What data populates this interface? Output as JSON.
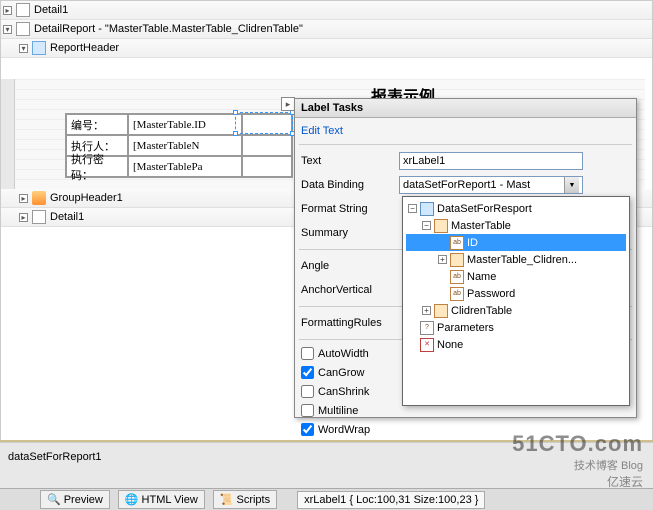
{
  "tree": {
    "detail1": "Detail1",
    "detailReport": "DetailReport - \"MasterTable.MasterTable_ClidrenTable\"",
    "reportHeader": "ReportHeader",
    "groupHeader": "GroupHeader1",
    "detail1b": "Detail1"
  },
  "design": {
    "title": "报表示例",
    "rows": [
      {
        "l": "编号：",
        "v": "[MasterTable.ID"
      },
      {
        "l": "执行人：",
        "v": "[MasterTableN"
      },
      {
        "l": "执行密码：",
        "v": "[MasterTablePa"
      }
    ]
  },
  "popup": {
    "title": "Label Tasks",
    "edit": "Edit Text",
    "props": {
      "text": {
        "label": "Text",
        "value": "xrLabel1"
      },
      "binding": {
        "label": "Data Binding",
        "value": "dataSetForReport1 - Mast"
      },
      "format": {
        "label": "Format String"
      },
      "summary": {
        "label": "Summary"
      },
      "angle": {
        "label": "Angle"
      },
      "anchor": {
        "label": "AnchorVertical"
      },
      "rules": {
        "label": "FormattingRules"
      }
    },
    "checks": {
      "autowidth": {
        "label": "AutoWidth",
        "checked": false
      },
      "cangrow": {
        "label": "CanGrow",
        "checked": true
      },
      "canshrink": {
        "label": "CanShrink",
        "checked": false
      },
      "multiline": {
        "label": "Multiline",
        "checked": false
      },
      "wordwrap": {
        "label": "WordWrap",
        "checked": true
      }
    }
  },
  "dropdown": {
    "ds": "DataSetForResport",
    "master": "MasterTable",
    "id": "ID",
    "clidren": "MasterTable_Clidren...",
    "name": "Name",
    "password": "Password",
    "clidrenTable": "ClidrenTable",
    "params": "Parameters",
    "none": "None"
  },
  "bottom": {
    "prop": "dataSetForReport1",
    "status": "xrLabel1 { Loc:100,31 Size:100,23 }",
    "tabs": {
      "preview": "Preview",
      "html": "HTML View",
      "scripts": "Scripts"
    }
  },
  "watermark": {
    "big": "51CTO.com",
    "sm": "技术博客  Blog",
    "sm2": "亿速云"
  }
}
